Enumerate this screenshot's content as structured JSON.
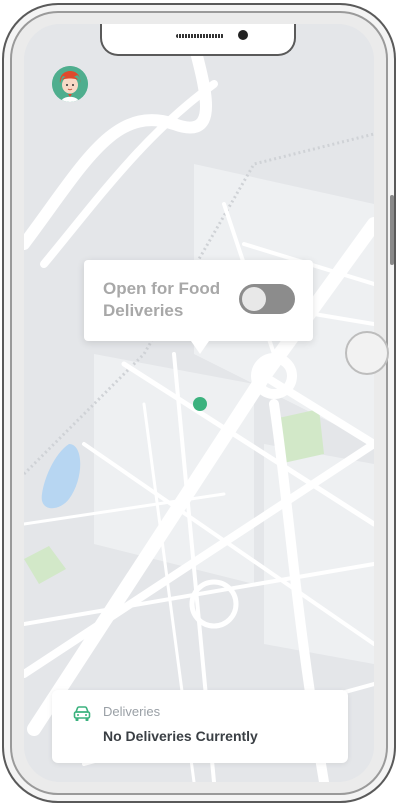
{
  "status_tooltip": {
    "text": "Open for Food Deliveries",
    "toggle_on": false
  },
  "deliveries_card": {
    "label": "Deliveries",
    "value": "No Deliveries Currently",
    "icon": "car-icon"
  },
  "colors": {
    "map_bg": "#e4e6e9",
    "road": "#ffffff",
    "park": "#d2e8c8",
    "water": "#b7d6f2",
    "accent_green": "#3bb27e",
    "toggle_off": "#8c8c8c"
  },
  "icons": [
    "avatar-icon",
    "location-marker-icon",
    "car-icon"
  ]
}
